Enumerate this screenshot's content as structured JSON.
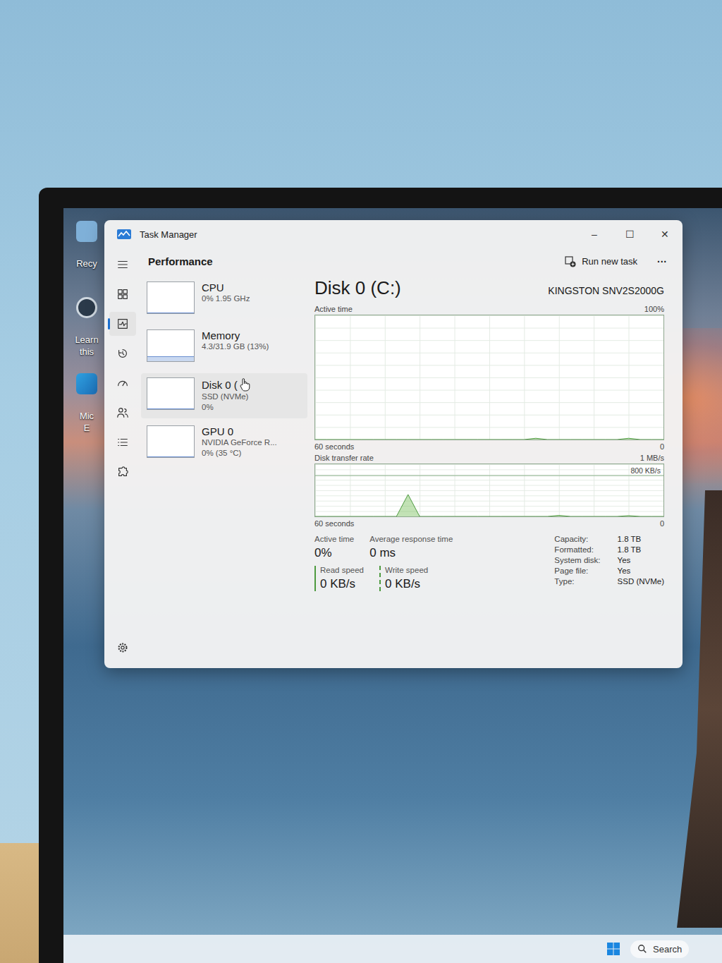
{
  "desktop": {
    "icons": [
      {
        "lines": [
          "Recy"
        ]
      },
      {
        "lines": [
          "Learn",
          "this"
        ]
      },
      {
        "lines": [
          "Mic",
          "E"
        ]
      }
    ]
  },
  "window": {
    "title": "Task Manager",
    "controls": [
      "–",
      "☐",
      "✕"
    ]
  },
  "nav": [
    {
      "selected": false
    },
    {
      "selected": false
    },
    {
      "selected": true
    },
    {
      "selected": false
    },
    {
      "selected": false
    },
    {
      "selected": false
    },
    {
      "selected": false
    },
    {
      "selected": false
    },
    {
      "selected": false
    }
  ],
  "header": {
    "title": "Performance",
    "action": "Run new task",
    "more": "···"
  },
  "devices": [
    {
      "name": "CPU",
      "details": [
        "0% 1.95 GHz"
      ],
      "selected": false,
      "level": 0
    },
    {
      "name": "Memory",
      "details": [
        "4.3/31.9 GB (13%)"
      ],
      "selected": false,
      "level": 0.13
    },
    {
      "name": "Disk 0 (",
      "details": [
        "SSD (NVMe)",
        "0%"
      ],
      "selected": true,
      "level": 0
    },
    {
      "name": "GPU 0",
      "details": [
        "NVIDIA GeForce R...",
        "0% (35 °C)"
      ],
      "selected": false,
      "level": 0
    }
  ],
  "detail": {
    "title": "Disk 0 (C:)",
    "model": "KINGSTON SNV2S2000G",
    "charts": [
      {
        "label": "Active time",
        "max_label": "100%",
        "span": "60 seconds",
        "zero": "0",
        "max": 100,
        "values": [
          0,
          0,
          0,
          0,
          0,
          0,
          0,
          0,
          0,
          0,
          0,
          0,
          0,
          0,
          0,
          0,
          0,
          0,
          0,
          1,
          0,
          0,
          0,
          0,
          0,
          0,
          0,
          1,
          0,
          0,
          0
        ]
      },
      {
        "label": "Disk transfer rate",
        "max_label": "1 MB/s",
        "marker_label": "800 KB/s",
        "marker": 800,
        "span": "60 seconds",
        "zero": "0",
        "max": 1024,
        "values": [
          0,
          0,
          0,
          0,
          0,
          0,
          0,
          0,
          430,
          0,
          0,
          0,
          0,
          0,
          0,
          0,
          0,
          0,
          0,
          0,
          0,
          20,
          0,
          0,
          0,
          0,
          0,
          15,
          0,
          0,
          0
        ]
      }
    ],
    "stats": [
      {
        "label": "Active time",
        "value": "0%"
      },
      {
        "label": "Average response time",
        "value": "0 ms"
      }
    ],
    "speeds": [
      {
        "label": "Read speed",
        "value": "0 KB/s",
        "dashed": false
      },
      {
        "label": "Write speed",
        "value": "0 KB/s",
        "dashed": true
      }
    ],
    "properties": [
      {
        "key": "Capacity:",
        "value": "1.8 TB"
      },
      {
        "key": "Formatted:",
        "value": "1.8 TB"
      },
      {
        "key": "System disk:",
        "value": "Yes"
      },
      {
        "key": "Page file:",
        "value": "Yes"
      },
      {
        "key": "Type:",
        "value": "SSD (NVMe)"
      }
    ]
  },
  "taskbar": {
    "search": "Search"
  }
}
